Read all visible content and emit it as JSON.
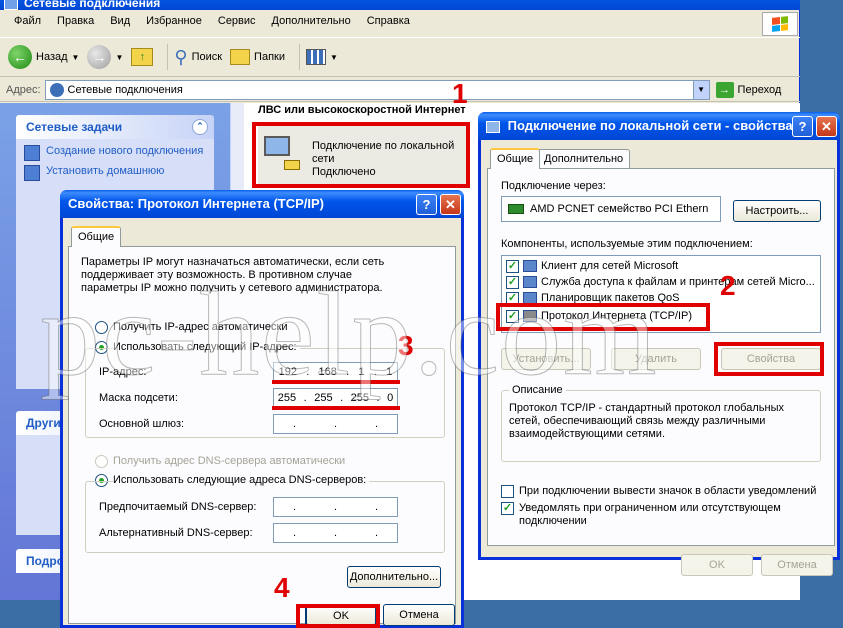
{
  "explorer": {
    "title": "Сетевые подключения",
    "menu": [
      "Файл",
      "Правка",
      "Вид",
      "Избранное",
      "Сервис",
      "Дополнительно",
      "Справка"
    ],
    "toolbar": {
      "back": "Назад",
      "search": "Поиск",
      "folders": "Папки"
    },
    "address": {
      "label": "Адрес:",
      "value": "Сетевые подключения",
      "go": "Переход"
    },
    "tasks": {
      "header": "Сетевые задачи",
      "items": [
        "Создание нового подключения",
        "Установить домашнюю"
      ],
      "other_header": "Други",
      "details_header": "Подро"
    },
    "group_title": "ЛВС или высокоскоростной Интернет",
    "connection": {
      "name": "Подключение по локальной сети",
      "status": "Подключено"
    }
  },
  "props_dialog": {
    "title": "Подключение по локальной сети - свойства",
    "tabs": [
      "Общие",
      "Дополнительно"
    ],
    "connect_via_label": "Подключение через:",
    "adapter": "AMD PCNET семейство PCI Ethern",
    "configure_button": "Настроить...",
    "components_label": "Компоненты, используемые этим подключением:",
    "components": [
      "Клиент для сетей Microsoft",
      "Служба доступа к файлам и принтерам сетей Micro...",
      "Планировщик пакетов QoS",
      "Протокол Интернета (TCP/IP)"
    ],
    "install_button": "Установить...",
    "remove_button": "Удалить",
    "properties_button": "Свойства",
    "description_group": "Описание",
    "description": "Протокол TCP/IP - стандартный протокол глобальных сетей, обеспечивающий связь между различными взаимодействующими сетями.",
    "show_icon": "При подключении вывести значок в области уведомлений",
    "notify_limited": "Уведомлять при ограниченном или отсутствующем подключении",
    "ok": "OK",
    "cancel": "Отмена"
  },
  "tcpip_dialog": {
    "title": "Свойства: Протокол Интернета (TCP/IP)",
    "tab": "Общие",
    "intro": "Параметры IP могут назначаться автоматически, если сеть поддерживает эту возможность. В противном случае параметры IP можно получить у сетевого администратора.",
    "auto_ip": "Получить IP-адрес автоматически",
    "manual_ip": "Использовать следующий IP-адрес:",
    "ip_label": "IP-адрес:",
    "ip": [
      "192",
      "168",
      "1",
      "1"
    ],
    "mask_label": "Маска подсети:",
    "mask": [
      "255",
      "255",
      "255",
      "0"
    ],
    "gateway_label": "Основной шлюз:",
    "auto_dns": "Получить адрес DNS-сервера автоматически",
    "manual_dns": "Использовать следующие адреса DNS-серверов:",
    "preferred_dns": "Предпочитаемый DNS-сервер:",
    "alternate_dns": "Альтернативный DNS-сервер:",
    "advanced_button": "Дополнительно...",
    "ok": "OK",
    "cancel": "Отмена"
  },
  "annotations": [
    "1",
    "2",
    "3",
    "4"
  ],
  "watermark": "pc-help.com",
  "colors": {
    "annotation_red": "#e00000",
    "xp_title_blue": "#0055ea"
  }
}
